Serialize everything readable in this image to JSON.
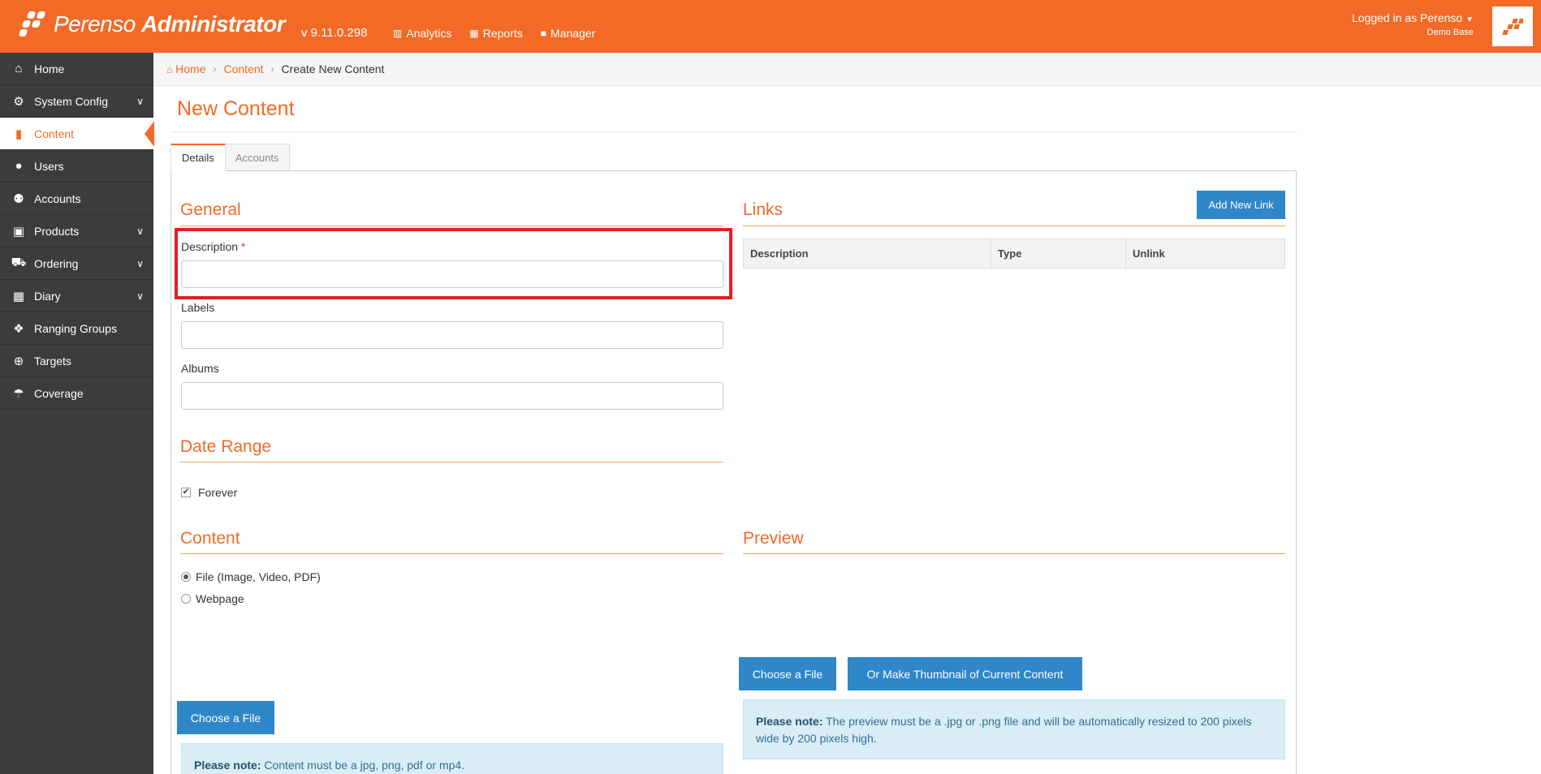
{
  "app": {
    "logo_name": "Perenso",
    "logo_suffix": "Administrator",
    "version": "v 9.11.0.298",
    "nav": [
      {
        "label": "Analytics",
        "icon": "chart-icon"
      },
      {
        "label": "Reports",
        "icon": "table-icon"
      },
      {
        "label": "Manager",
        "icon": "briefcase-icon"
      }
    ],
    "user": {
      "logged_in": "Logged in as Perenso",
      "base": "Demo Base"
    },
    "accent_color": "#f36a26",
    "button_color": "#2f86c9"
  },
  "sidebar": {
    "items": [
      {
        "label": "Home",
        "icon": "home-icon"
      },
      {
        "label": "System Config",
        "icon": "gear-icon",
        "expandable": true
      },
      {
        "label": "Content",
        "icon": "file-icon",
        "active": true
      },
      {
        "label": "Users",
        "icon": "user-icon"
      },
      {
        "label": "Accounts",
        "icon": "users-icon"
      },
      {
        "label": "Products",
        "icon": "gift-icon",
        "expandable": true
      },
      {
        "label": "Ordering",
        "icon": "cart-icon",
        "expandable": true
      },
      {
        "label": "Diary",
        "icon": "calendar-icon",
        "expandable": true
      },
      {
        "label": "Ranging Groups",
        "icon": "cubes-icon"
      },
      {
        "label": "Targets",
        "icon": "crosshairs-icon"
      },
      {
        "label": "Coverage",
        "icon": "umbrella-icon"
      }
    ]
  },
  "breadcrumb": {
    "home": "Home",
    "content": "Content",
    "current": "Create New Content"
  },
  "page": {
    "title": "New Content",
    "tabs": [
      "Details",
      "Accounts"
    ]
  },
  "general": {
    "title": "General",
    "description_label": "Description",
    "required_mark": "*",
    "description_value": "",
    "labels_label": "Labels",
    "labels_value": "",
    "albums_label": "Albums",
    "albums_value": ""
  },
  "links": {
    "title": "Links",
    "add_button": "Add New Link",
    "columns": [
      "Description",
      "Type",
      "Unlink"
    ]
  },
  "date_range": {
    "title": "Date Range",
    "forever_label": "Forever",
    "forever_checked": true
  },
  "content": {
    "title": "Content",
    "options": [
      "File (Image, Video, PDF)",
      "Webpage"
    ],
    "selected": "File (Image, Video, PDF)",
    "choose_button": "Choose a File",
    "note_bold": "Please note:",
    "note_text": " Content must be a jpg, png, pdf or mp4."
  },
  "preview": {
    "title": "Preview",
    "choose_button": "Choose a File",
    "thumbnail_button": "Or Make Thumbnail of Current Content",
    "note_bold": "Please note:",
    "note_text": " The preview must be a .jpg or .png file and will be automatically resized to 200 pixels wide by 200 pixels high."
  }
}
